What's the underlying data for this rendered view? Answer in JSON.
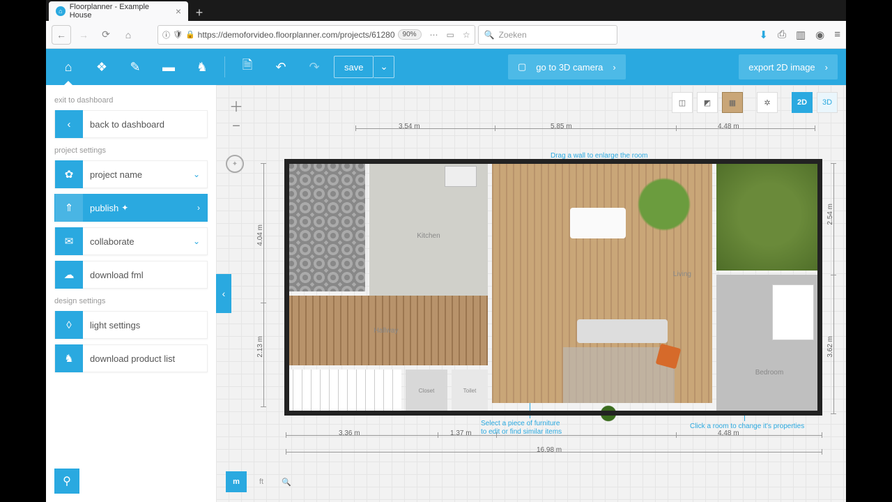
{
  "browser": {
    "tab_title": "Floorplanner - Example House",
    "url": "https://demoforvideo.floorplanner.com/projects/61280",
    "zoom": "90%",
    "search_placeholder": "Zoeken"
  },
  "toolbar": {
    "save": "save",
    "cta": "go to 3D camera",
    "export": "export 2D image"
  },
  "sidebar": {
    "label_exit": "exit to dashboard",
    "back": "back to dashboard",
    "label_project": "project settings",
    "project_name": "project name",
    "publish": "publish",
    "collaborate": "collaborate",
    "download_fml": "download fml",
    "label_design": "design settings",
    "light": "light settings",
    "product_list": "download product list"
  },
  "view": {
    "twoD": "2D",
    "threeD": "3D"
  },
  "units": {
    "m": "m",
    "ft": "ft"
  },
  "rooms": {
    "kitchen": "Kitchen",
    "living": "Living",
    "hall": "Hallway",
    "closet": "Closet",
    "toilet": "Toilet",
    "bedroom": "Bedroom"
  },
  "dims": {
    "top1": "3.54 m",
    "top2": "5.85 m",
    "top3": "4.48 m",
    "left1": "4.04 m",
    "left2": "2.13 m",
    "right1": "2.54 m",
    "right2": "3.62 m",
    "bot1": "3.36 m",
    "bot2": "1.37 m",
    "bot3": "4.48 m",
    "bot4": "16.98 m"
  },
  "hints": {
    "wall": "Drag a wall to enlarge the room",
    "furniture1": "Select a piece of furniture",
    "furniture2": "to edit or find similar items",
    "room": "Click a room to change it's properties"
  }
}
